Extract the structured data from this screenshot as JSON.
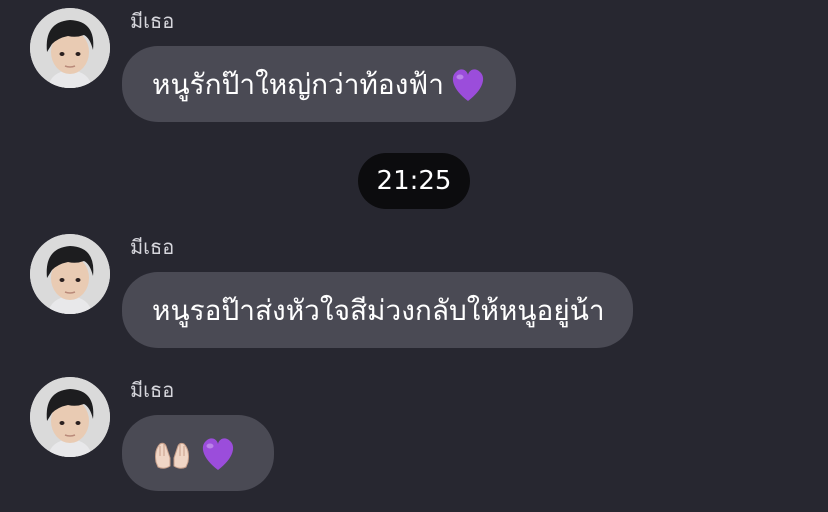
{
  "messages": [
    {
      "sender": "มีเธอ",
      "text": "หนูรักป๊าใหญ่กว่าท้องฟ้า",
      "trailing_icon": "purple-heart-icon"
    },
    {
      "sender": "มีเธอ",
      "text": "หนูรอป๊าส่งหัวใจสีม่วงกลับให้หนูอยู่น้า"
    },
    {
      "sender": "มีเธอ",
      "text": "",
      "icons": [
        "palms-up-together-icon",
        "purple-heart-icon"
      ]
    }
  ],
  "timestamp": "21:25",
  "colors": {
    "background": "#272730",
    "bubble": "#4a4a54",
    "time_pill": "#0c0c0e",
    "heart": "#9b4ddb"
  }
}
